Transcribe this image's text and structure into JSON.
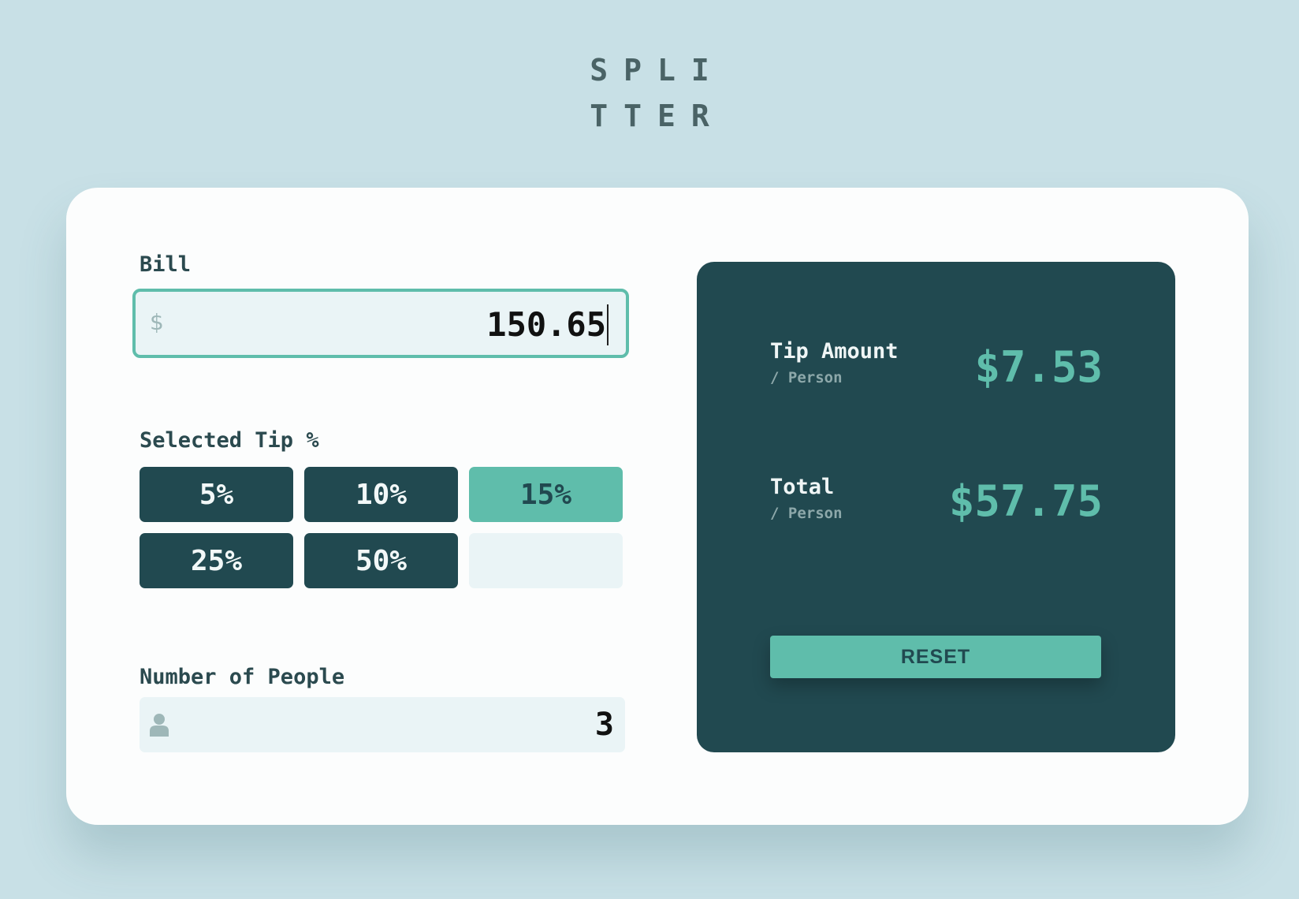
{
  "app": {
    "logo_line1": "SPLI",
    "logo_line2": "TTER"
  },
  "bill": {
    "label": "Bill",
    "currency_symbol": "$",
    "value": "150.65"
  },
  "tip": {
    "label": "Selected Tip %",
    "options": [
      "5%",
      "10%",
      "15%",
      "25%",
      "50%"
    ],
    "selected": "15%",
    "custom_placeholder": ""
  },
  "people": {
    "label": "Number of People",
    "value": "3",
    "icon": "person-icon"
  },
  "results": {
    "tip_amount_label": "Tip Amount",
    "tip_amount_sub": "/ Person",
    "tip_amount_value": "$7.53",
    "total_label": "Total",
    "total_sub": "/ Person",
    "total_value": "$57.75",
    "reset_label": "RESET"
  },
  "colors": {
    "background": "#c8e0e6",
    "card": "#fcfdfd",
    "dark_cyan": "#214950",
    "accent": "#5fbdab",
    "input_bg": "#eaf4f6"
  }
}
